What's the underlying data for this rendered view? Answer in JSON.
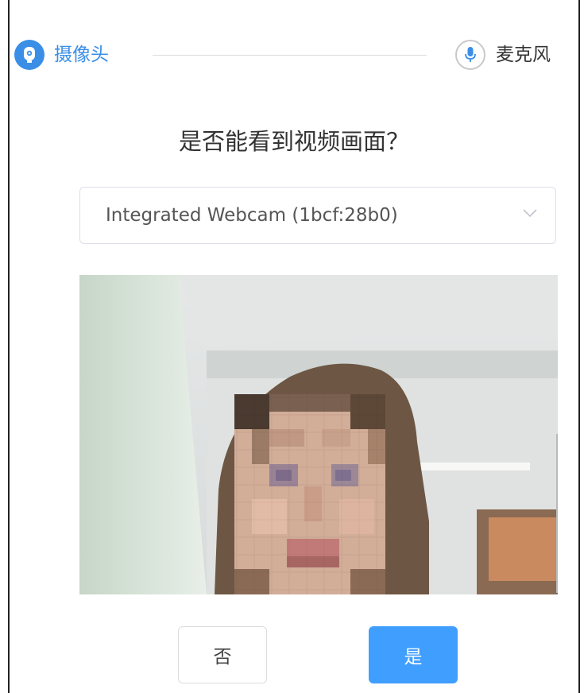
{
  "steps": {
    "camera_label": "摄像头",
    "microphone_label": "麦克风"
  },
  "question": "是否能看到视频画面？",
  "device_select": {
    "selected_value": "Integrated Webcam (1bcf:28b0)"
  },
  "buttons": {
    "no_label": "否",
    "yes_label": "是"
  },
  "colors": {
    "accent": "#409eff",
    "active_step": "#3a8ee6"
  }
}
